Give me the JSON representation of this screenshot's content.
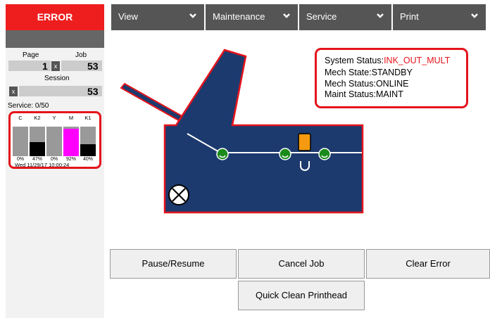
{
  "sidebar": {
    "error_label": "ERROR",
    "page_label": "Page",
    "job_label": "Job",
    "page_value": "1",
    "job_value": "53",
    "clear_symbol": "x",
    "session_label": "Session",
    "session_value": "53",
    "service_text": "Service:  0/50",
    "ink": {
      "columns": [
        {
          "label": "C",
          "percent_text": "0%",
          "level": 0,
          "color": "#000000"
        },
        {
          "label": "K2",
          "percent_text": "47%",
          "level": 0.47,
          "color": "#000000"
        },
        {
          "label": "Y",
          "percent_text": "0%",
          "level": 0,
          "color": "#000000"
        },
        {
          "label": "M",
          "percent_text": "92%",
          "level": 0.92,
          "color": "#ff00ff"
        },
        {
          "label": "K1",
          "percent_text": "40%",
          "level": 0.4,
          "color": "#000000"
        }
      ],
      "timestamp": "Wed 11/29/17 10:00:24"
    }
  },
  "nav": {
    "items": [
      {
        "label": "View"
      },
      {
        "label": "Maintenance"
      },
      {
        "label": "Service"
      },
      {
        "label": "Print"
      }
    ]
  },
  "status": {
    "system_label": "System Status:",
    "system_value": "INK_OUT_MULT",
    "system_value_color": "#e4141c",
    "mech_state_label": "Mech State:",
    "mech_state_value": "STANDBY",
    "mech_status_label": "Mech Status:",
    "mech_status_value": "ONLINE",
    "maint_status_label": "Maint Status:",
    "maint_status_value": "MAINT"
  },
  "diagram": {
    "printer_body_color": "#1c3a6e",
    "outline_color": "#e4141c",
    "roller_color": "#1a8a1a",
    "printhead_color": "#f59a10"
  },
  "buttons": {
    "pause_resume": "Pause/Resume",
    "cancel_job": "Cancel Job",
    "clear_error": "Clear Error",
    "quick_clean": "Quick Clean Printhead"
  }
}
